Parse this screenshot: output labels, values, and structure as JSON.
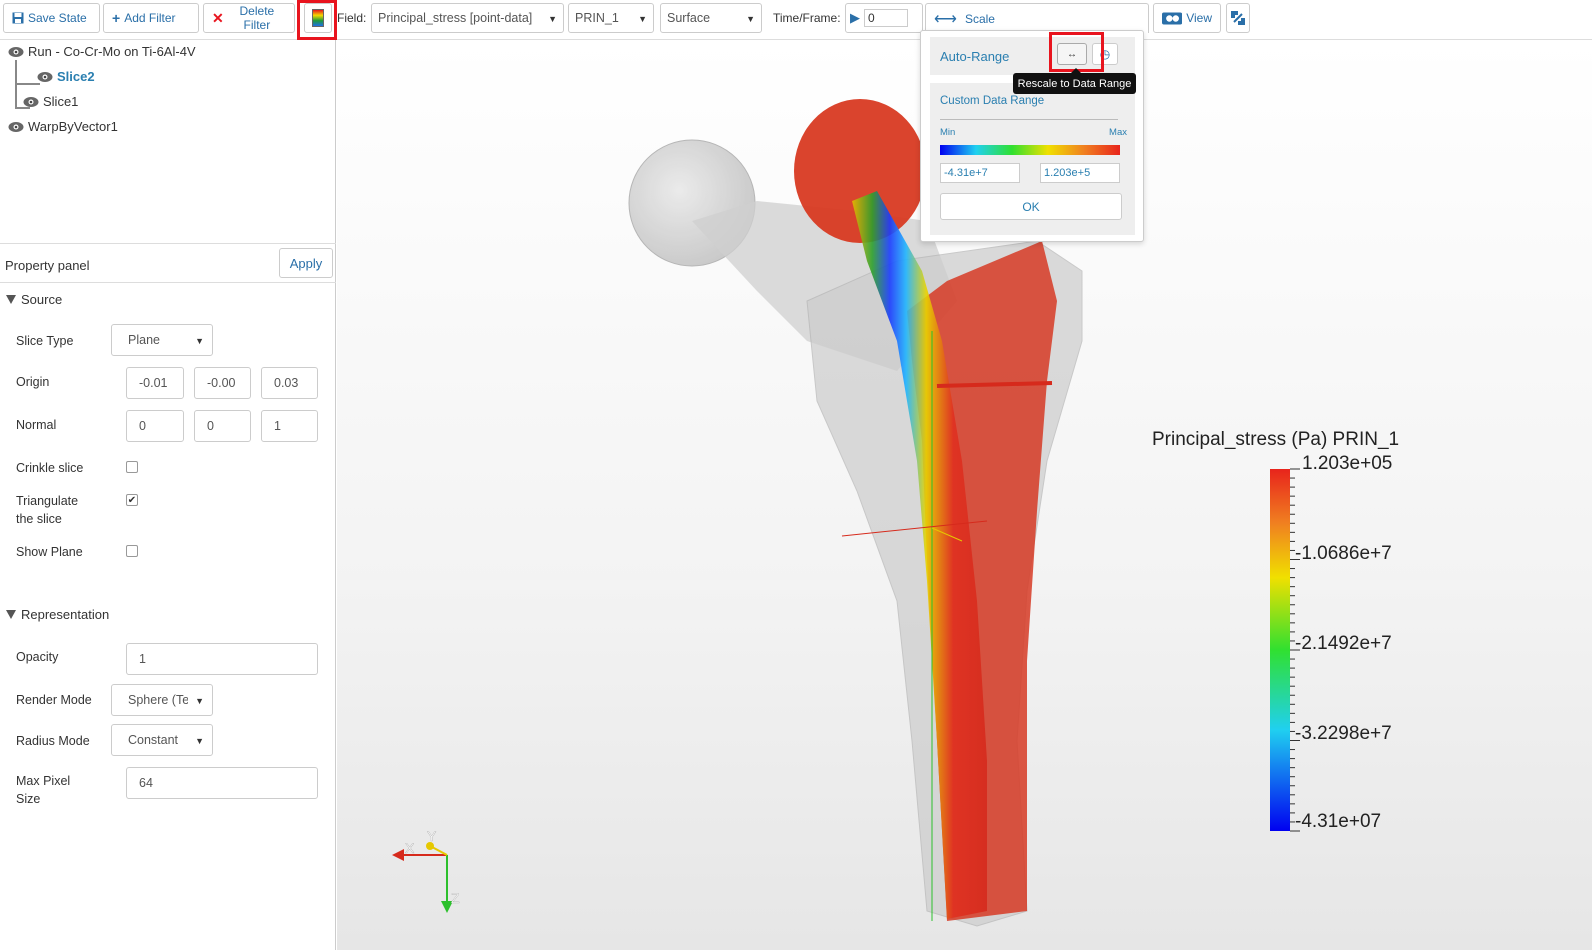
{
  "toolbar": {
    "save_state": "Save State",
    "add_filter": "Add Filter",
    "delete_filter": "Delete Filter",
    "field_label": "Field:",
    "field_value": "Principal_stress [point-data]",
    "component_value": "PRIN_1",
    "representation_value": "Surface",
    "time_label": "Time/Frame:",
    "time_value": "0",
    "scale_label": "Scale",
    "view_label": "View"
  },
  "tree": [
    {
      "label": "Run - Co-Cr-Mo on Ti-6Al-4V"
    },
    {
      "label": "Slice2"
    },
    {
      "label": "Slice1"
    },
    {
      "label": "WarpByVector1"
    }
  ],
  "property_panel": {
    "title": "Property panel",
    "apply": "Apply",
    "source_section": "Source",
    "slice_type_label": "Slice Type",
    "slice_type_value": "Plane",
    "origin_label": "Origin",
    "origin": [
      "-0.01",
      "-0.00",
      "0.03"
    ],
    "normal_label": "Normal",
    "normal": [
      "0",
      "0",
      "1"
    ],
    "crinkle_label": "Crinkle slice",
    "crinkle_checked": false,
    "triangulate_label_1": "Triangulate",
    "triangulate_label_2": "the slice",
    "triangulate_checked": true,
    "show_plane_label": "Show Plane",
    "show_plane_checked": false,
    "representation_section": "Representation",
    "opacity_label": "Opacity",
    "opacity_value": "1",
    "render_mode_label": "Render Mode",
    "render_mode_value": "Sphere (Te",
    "radius_mode_label": "Radius Mode",
    "radius_mode_value": "Constant",
    "max_pixel_label_1": "Max Pixel",
    "max_pixel_label_2": "Size",
    "max_pixel_value": "64"
  },
  "scale_popup": {
    "auto_range": "Auto-Range",
    "tooltip": "Rescale to Data Range",
    "custom_range": "Custom Data Range",
    "min_label": "Min",
    "max_label": "Max",
    "min_value": "-4.31e+7",
    "max_value": "1.203e+5",
    "ok": "OK"
  },
  "legend": {
    "title": "Principal_stress (Pa) PRIN_1",
    "labels": [
      "1.203e+05",
      "-1.0686e+7",
      "-2.1492e+7",
      "-3.2298e+7",
      "-4.31e+07"
    ]
  },
  "axes": {
    "x": "X",
    "y": "Y",
    "z": "Z"
  },
  "colors": {
    "accent": "#2a6fa8",
    "highlight": "#e8141e",
    "stress_high": "#e0301e",
    "stress_low": "#0000ff"
  }
}
